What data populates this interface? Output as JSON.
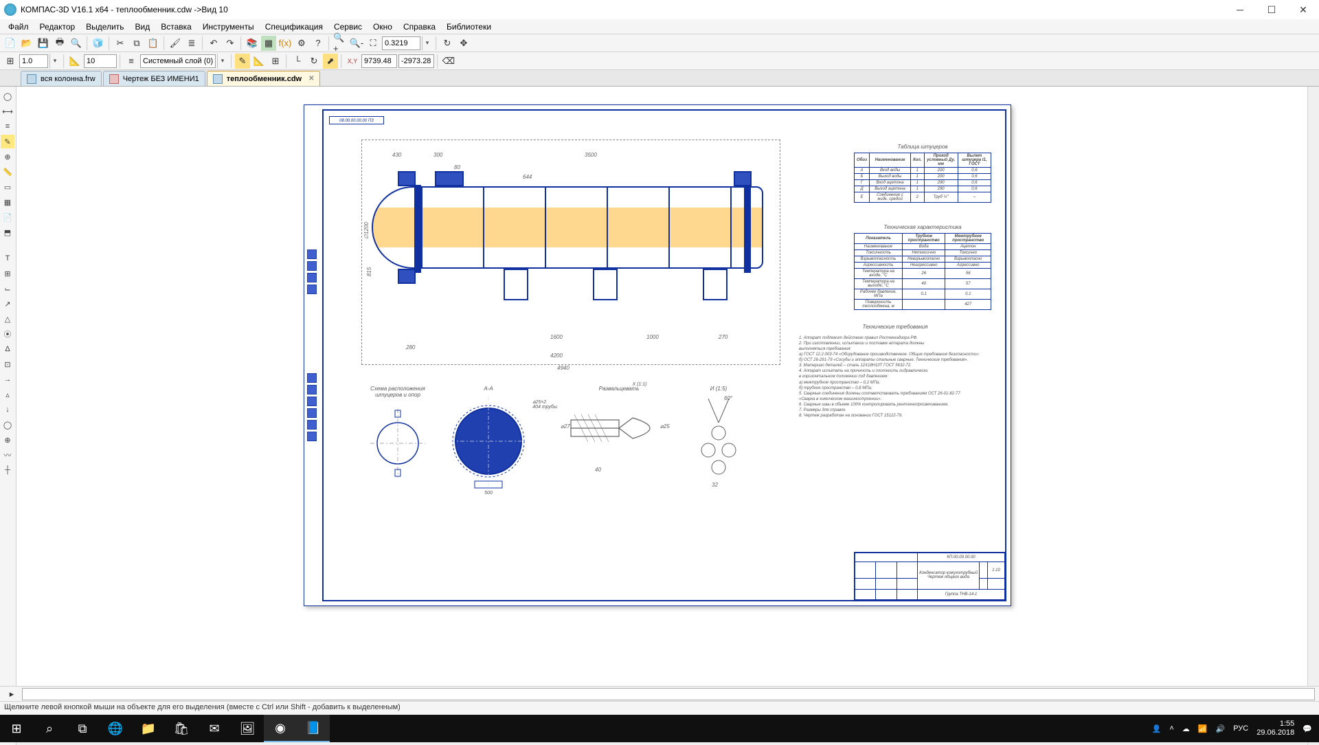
{
  "window": {
    "title": "КОМПАС-3D V16.1 x64 - теплообменник.cdw ->Вид 10"
  },
  "menu": [
    "Файл",
    "Редактор",
    "Выделить",
    "Вид",
    "Вставка",
    "Инструменты",
    "Спецификация",
    "Сервис",
    "Окно",
    "Справка",
    "Библиотеки"
  ],
  "toolbar2": {
    "scale": "1.0",
    "size": "10",
    "layer": "Системный слой (0)",
    "coord_x": "9739.48",
    "coord_y": "-2973.28"
  },
  "zoom": "0.3219",
  "tabs": [
    {
      "label": "вся колонна.frw",
      "active": false
    },
    {
      "label": "Чертеж БЕЗ ИМЕНИ1",
      "active": false
    },
    {
      "label": "теплообменник.cdw",
      "active": true
    }
  ],
  "drawing": {
    "ref": "08.00.00.00.00 ПЗ",
    "dims": {
      "d1": "430",
      "d2": "300",
      "d3": "3500",
      "d4": "644",
      "d5": "80",
      "d6": "280",
      "d7": "4200",
      "d8": "4940",
      "d9": "1600",
      "d10": "270",
      "d11": "1000",
      "d12": "∅1200",
      "d13": "815"
    },
    "table_nozzles": {
      "title": "Таблица штуцеров",
      "headers": [
        "Обоз",
        "Наименование",
        "Кол.",
        "Проход условный Ду, мм",
        "Вылет штуцера l1, ГОСТ"
      ],
      "rows": [
        [
          "А",
          "Вход воды",
          "1",
          "200",
          "0,6"
        ],
        [
          "Б",
          "Выход воды",
          "1",
          "200",
          "0,6"
        ],
        [
          "Г",
          "Вход ацетона",
          "1",
          "290",
          "0,6"
        ],
        [
          "Д",
          "Выход ацетона",
          "1",
          "290",
          "0,6"
        ],
        [
          "Е",
          "Соединение с жидк. средой",
          "2",
          "Труб ½\"",
          "–"
        ]
      ]
    },
    "tech_char": {
      "title": "Техническая характеристика",
      "col_headers": [
        "Показатель",
        "Трубное пространство",
        "Межтрубное пространство"
      ],
      "rows": [
        [
          "Наименование",
          "Вода",
          "Ацетон"
        ],
        [
          "Токсичность",
          "Нетоксично",
          "Токсично"
        ],
        [
          "Взрывоопасность",
          "Невзрывоопасно",
          "Взрывоопасно"
        ],
        [
          "Агрессивность",
          "Неагрессивно",
          "Агрессивно"
        ],
        [
          "Температура на входе, °C",
          "26",
          "56"
        ],
        [
          "Температура на выходе, °C",
          "40",
          "57"
        ],
        [
          "Рабочее давление, МПа",
          "0,1",
          "0,1"
        ],
        [
          "Поверхность теплообмена, м",
          "",
          "427"
        ]
      ]
    },
    "tech_req": {
      "title": "Технические требования",
      "lines": [
        "1. Аппарат подлежит действию правил Ростехнадзора РФ.",
        "2. При изготовлении, испытании и поставке аппарата должны",
        "выполняться требования:",
        "а) ГОСТ 12.2.003-74 «Оборудование производственное. Общие требования безопасности»;",
        "б) ОСТ 26-291-79 «Сосуды и аппараты стальные сварные. Технические требования».",
        "3. Материал деталей – сталь 12Х18Н10Т ГОСТ 5632-72.",
        "4. Аппарат испытать на прочность и плотность гидравлически",
        "в горизонтальном положении под давлением:",
        "а) межтрубное пространство – 0,2 МПа;",
        "б) трубное пространство – 0,8 МПа.",
        "5. Сварные соединения должны соответствовать требованиям ОСТ 26-01-82-77",
        "«Сварка в химическом машиностроении».",
        "6. Сварные швы в объеме 100% контролировать рентгенопросвечиванием.",
        "7. Размеры для справок.",
        "8. Чертеж разработан на основании ГОСТ 15122-79."
      ]
    },
    "sections": {
      "scheme": "Схема расположения штуцеров и опор",
      "aa": "А-А",
      "tubes": "⌀25×2\n404 трубы",
      "weld": "Развальцевать",
      "sec_x": "Х (1:1)",
      "sec_w": "И (1:5)",
      "d_500": "500",
      "d60": "60°",
      "d32": "32",
      "d40": "40",
      "d27": "⌀27",
      "d25": "⌀25"
    },
    "title_block": {
      "code": "КП.00.00.00.00",
      "name1": "Конденсатор кожухотрубный",
      "name2": "Чертеж общего вида",
      "group": "Группа ТНВ-14-1"
    }
  },
  "status": "Щелкните левой кнопкой мыши на объекте для его выделения (вместе с Ctrl или Shift - добавить к выделенным)",
  "taskbar": {
    "lang": "РУС",
    "time": "1:55",
    "date": "29.06.2018"
  }
}
